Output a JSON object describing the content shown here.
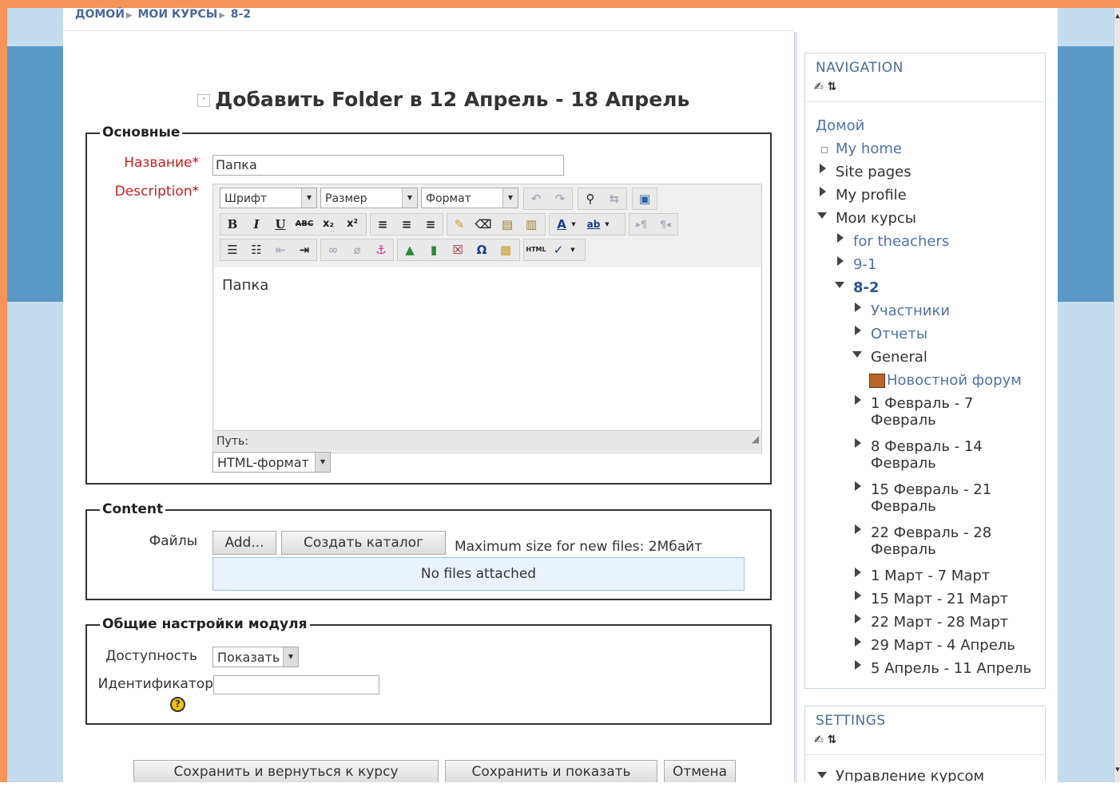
{
  "breadcrumb": {
    "home": "ДОМОЙ",
    "courses": "МОИ КУРСЫ",
    "current": "8-2",
    "separator": "▶"
  },
  "page_title": "Добавить Folder в 12 Апрель - 18 Апрель",
  "sections": {
    "general": {
      "legend": "Основные",
      "name_label": "Название",
      "name_value": "Папка",
      "description_label": "Description",
      "required_mark": "*"
    },
    "content": {
      "legend": "Content",
      "files_label": "Файлы",
      "add_button": "Add...",
      "create_folder_button": "Создать каталог",
      "max_size_text": "Maximum size for new files: 2Мбайт",
      "no_files_text": "No files attached"
    },
    "module_settings": {
      "legend": "Общие настройки модуля",
      "visibility_label": "Доступность",
      "visibility_value": "Показать",
      "idnumber_label": "Идентификатор",
      "idnumber_value": "",
      "help_glyph": "?"
    }
  },
  "editor": {
    "font_select": "Шрифт",
    "size_select": "Размер",
    "format_select": "Формат",
    "content_text": "Папка",
    "path_label": "Путь:",
    "format_dropdown": "HTML-формат",
    "buttons": {
      "bold": "B",
      "italic": "I",
      "underline": "U",
      "strike": "ABC",
      "subscript": "x₂",
      "superscript": "x²",
      "html": "HTML",
      "omega": "Ω",
      "text_color": "A",
      "highlight": "ab"
    }
  },
  "actions": {
    "save_return": "Сохранить и вернуться к курсу",
    "save_display": "Сохранить и показать",
    "cancel": "Отмена"
  },
  "navigation": {
    "title": "NAVIGATION",
    "items": {
      "home": "Домой",
      "my_home": "My home",
      "site_pages": "Site pages",
      "my_profile": "My profile",
      "my_courses": "Мои курсы",
      "for_teachers": "for theachers",
      "course_91": "9-1",
      "course_82": "8-2",
      "participants": "Участники",
      "reports": "Отчеты",
      "general": "General",
      "news_forum": "Новостной форум",
      "w1_a": "1 Февраль - 7",
      "w1_b": "Февраль",
      "w2_a": "8 Февраль - 14",
      "w2_b": "Февраль",
      "w3_a": "15 Февраль - 21",
      "w3_b": "Февраль",
      "w4_a": "22 Февраль - 28",
      "w4_b": "Февраль",
      "w5": "1 Март - 7 Март",
      "w6": "15 Март - 21 Март",
      "w7": "22 Март - 28 Март",
      "w8": "29 Март - 4 Апрель",
      "w9": "5 Апрель - 11 Апрель"
    }
  },
  "settings": {
    "title": "SETTINGS",
    "course_admin": "Управление курсом"
  }
}
